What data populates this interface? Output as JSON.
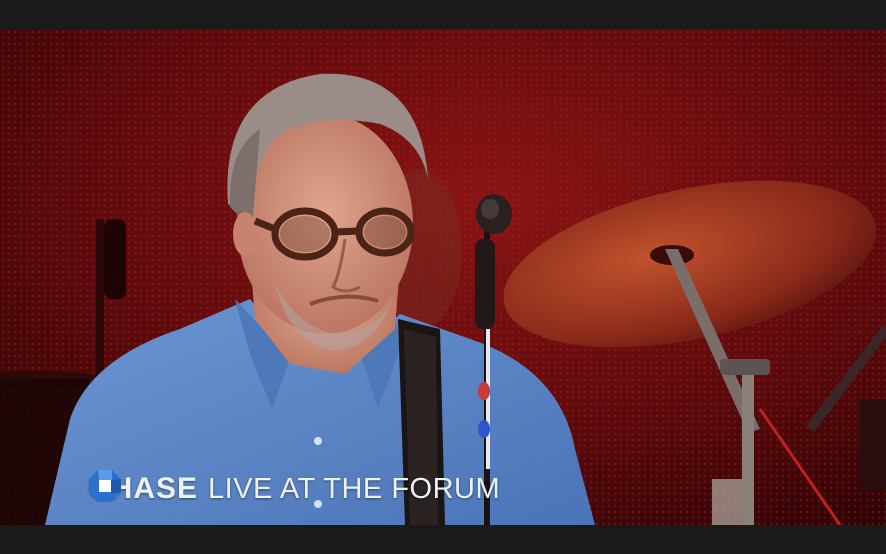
{
  "overlay": {
    "brand": "CHASE",
    "brand_icon": "chase-octagon-logo-icon",
    "show_title": "LIVE AT THE FORUM"
  },
  "colors": {
    "backdrop": "#5a0a0c",
    "shirt": "#5b86c6",
    "overlay_text": "#eef1f7",
    "brand_mark": "#2b6fd1",
    "letterbox": "#1a1a1a"
  }
}
